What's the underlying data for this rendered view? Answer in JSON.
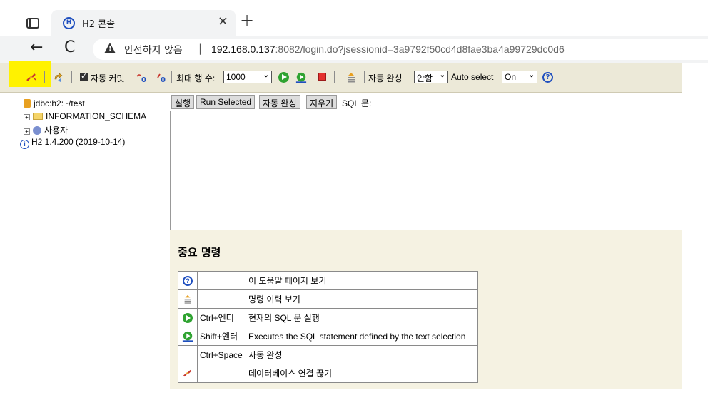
{
  "browser": {
    "tab_title": "H2 콘솔",
    "tab_close": "×",
    "new_tab": "+",
    "back": "←",
    "reload": "C",
    "security_text": "안전하지 않음",
    "separator": "|",
    "url_host": "192.168.0.137",
    "url_rest": ":8082/login.do?jsessionid=3a9792f50cd4d8fae3ba4a99729dc0d6"
  },
  "toolbar": {
    "auto_commit_label": "자동 커밋",
    "max_rows_label": "최대 행 수:",
    "max_rows_value": "1000",
    "autocomplete_label": "자동 완성",
    "autocomplete_value": "안함",
    "auto_select_label": "Auto select",
    "auto_select_value": "On",
    "help_glyph": "?"
  },
  "tree": {
    "items": [
      {
        "label": "jdbc:h2:~/test",
        "icon": "database-icon"
      },
      {
        "label": "INFORMATION_SCHEMA",
        "icon": "folder-icon"
      },
      {
        "label": "사용자",
        "icon": "users-icon"
      },
      {
        "label": "H2 1.4.200 (2019-10-14)",
        "icon": "info-icon"
      }
    ]
  },
  "query": {
    "run_label": "실행",
    "run_selected_label": "Run Selected",
    "autocomplete_label": "자동 완성",
    "clear_label": "지우기",
    "sql_label": "SQL 문:"
  },
  "help": {
    "title": "중요 명령",
    "rows": [
      {
        "icon": "help-icon",
        "key": "",
        "desc": "이 도움말 페이지 보기"
      },
      {
        "icon": "history-icon",
        "key": "",
        "desc": "명령 이력 보기"
      },
      {
        "icon": "run-icon",
        "key": "Ctrl+엔터",
        "desc": "현재의 SQL 문 실행"
      },
      {
        "icon": "run-selected-icon",
        "key": "Shift+엔터",
        "desc": "Executes the SQL statement defined by the text selection"
      },
      {
        "icon": "",
        "key": "Ctrl+Space",
        "desc": "자동 완성"
      },
      {
        "icon": "disconnect-icon",
        "key": "",
        "desc": "데이터베이스 연결 끊기"
      }
    ]
  },
  "colors": {
    "toolbar_bg": "#ece9d8",
    "highlight": "#fff200",
    "help_bg": "#f5f2e2",
    "run_green": "#2fa331",
    "stop_red": "#e4312f"
  }
}
